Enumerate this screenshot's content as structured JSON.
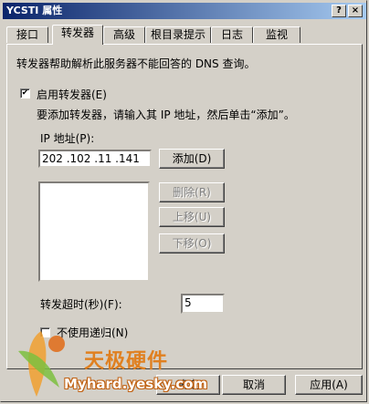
{
  "window": {
    "title": "YCSTI 属性",
    "help_btn": "?",
    "close_btn": "×"
  },
  "tabs": [
    {
      "label": "接口"
    },
    {
      "label": "转发器"
    },
    {
      "label": "高级"
    },
    {
      "label": "根目录提示"
    },
    {
      "label": "日志"
    },
    {
      "label": "监视"
    }
  ],
  "forwarders": {
    "description": "转发器帮助解析此服务器不能回答的 DNS 查询。",
    "enable_checkbox": {
      "label": "启用转发器(E)",
      "checked": true
    },
    "instruction": "要添加转发器，请输入其 IP 地址，然后单击“添加”。",
    "ip_label": "IP 地址(P):",
    "ip_value": "202 .102 .11  .141",
    "buttons": {
      "add": "添加(D)",
      "remove": "删除(R)",
      "move_up": "上移(U)",
      "move_down": "下移(O)"
    },
    "timeout_label": "转发超时(秒)(F):",
    "timeout_value": "5",
    "no_recursion": {
      "label": "不使用递归(N)",
      "checked": false
    }
  },
  "footer": {
    "ok": "确定",
    "cancel": "取消",
    "apply": "应用(A)"
  },
  "watermark": {
    "title": "天极硬件",
    "url": "Myhard.yesky.com"
  }
}
